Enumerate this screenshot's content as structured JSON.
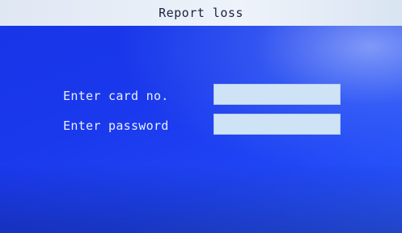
{
  "window": {
    "title": "Report loss"
  },
  "form": {
    "card_label": "Enter card no.",
    "card_value": "",
    "password_label": "Enter password",
    "password_value": ""
  },
  "colors": {
    "background": "#1a38ec",
    "title_bar": "#e6edf7",
    "field": "#cfe3f7",
    "label_text": "#e8f0ff"
  }
}
